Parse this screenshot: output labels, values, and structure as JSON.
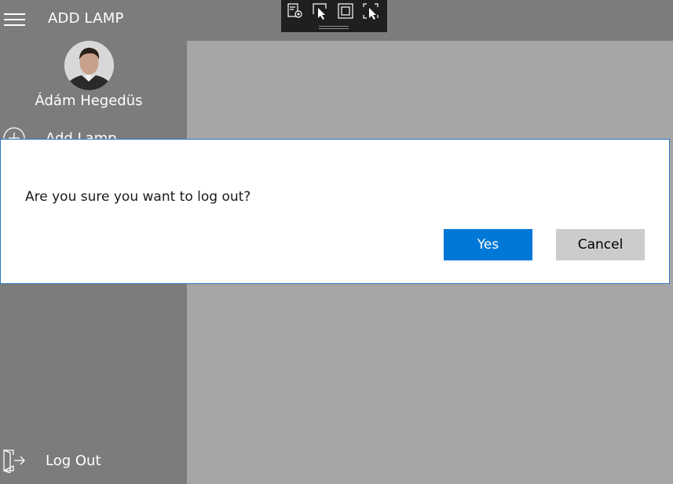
{
  "header": {
    "title": "ADD LAMP",
    "menu_icon": "hamburger-menu-icon"
  },
  "debug_toolbar": {
    "buttons": [
      {
        "icon": "live-visual-tree-icon"
      },
      {
        "icon": "select-element-icon"
      },
      {
        "icon": "display-layout-adorners-icon"
      },
      {
        "icon": "track-focus-icon"
      }
    ]
  },
  "sidebar": {
    "user_name": "Ádám Hegedüs",
    "avatar_icon": "user-avatar",
    "items": [
      {
        "label": "Add Lamp",
        "icon": "add-circle-icon"
      },
      {
        "label": "Log Out",
        "icon": "sign-out-icon"
      }
    ]
  },
  "dialog": {
    "message": "Are you sure you want to log out?",
    "primary_label": "Yes",
    "secondary_label": "Cancel",
    "primary_color": "#0078d7",
    "secondary_color": "#cccccc"
  },
  "colors": {
    "sidebar_bg": "#7c7c7c",
    "content_bg": "#a6a6a6",
    "dialog_border": "#2b78c2"
  }
}
